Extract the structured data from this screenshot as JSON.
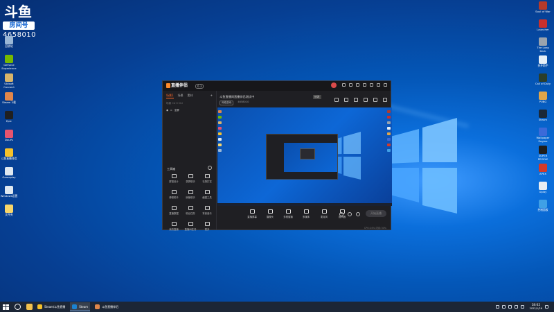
{
  "watermark": {
    "brand_glyph": "斗鱼",
    "tag": "房间号",
    "number": "4658010"
  },
  "desktop": {
    "left_icons": [
      {
        "label": "回收站",
        "color": "#9ab7d6"
      },
      {
        "label": "GeForce Experience",
        "color": "#76b900"
      },
      {
        "label": "Ubisoft Connect",
        "color": "#d7b46a"
      },
      {
        "label": "Steam下载",
        "color": "#e0864b"
      },
      {
        "label": "Epic",
        "color": "#202020"
      },
      {
        "label": "DouYu",
        "color": "#e7546f"
      },
      {
        "label": "斗鱼直播伴侣",
        "color": "#f6c12a"
      },
      {
        "label": "Gameplay",
        "color": "#dfe8f0"
      },
      {
        "label": "Windows设置",
        "color": "#dfe8f0"
      },
      {
        "label": "文件夹",
        "color": "#f7d56a"
      }
    ],
    "right_icons": [
      {
        "label": "Soul of War",
        "color": "#b53a2a"
      },
      {
        "label": "Launcher",
        "color": "#c9302c"
      },
      {
        "label": "The Long Dark",
        "color": "#9aa3ad"
      },
      {
        "label": "多开助手",
        "color": "#e7f0f7"
      },
      {
        "label": "Call of Duty",
        "color": "#2b3e2b"
      },
      {
        "label": "PUBG",
        "color": "#e0a64a"
      },
      {
        "label": "Steam",
        "color": "#1b2838"
      },
      {
        "label": "Wallpaper Engine",
        "color": "#3b6ad9"
      },
      {
        "label": "SUPER PEOPLE",
        "color": "#1d1d1d"
      },
      {
        "label": "APEX",
        "color": "#d33a2a"
      },
      {
        "label": "Uplay",
        "color": "#e9edf2"
      },
      {
        "label": "控制面板",
        "color": "#3fa0e6"
      }
    ]
  },
  "app": {
    "logo_text": "直播伴侣",
    "version_badge": "6.3",
    "tabs": [
      {
        "label": "场景1",
        "active": true
      },
      {
        "label": "场景",
        "active": false
      },
      {
        "label": "素材",
        "active": false
      }
    ],
    "scene_label": "场景 Ctrl+Ctrl",
    "layer_label": "全屏",
    "tools_title": "工具箱",
    "tools": [
      {
        "label": "屏幕设计"
      },
      {
        "label": "录屏助手"
      },
      {
        "label": "礼物打赏"
      },
      {
        "label": "弹幕助手"
      },
      {
        "label": "房管助手"
      },
      {
        "label": "截图工具"
      },
      {
        "label": "直播数据"
      },
      {
        "label": "粉丝任务"
      },
      {
        "label": "背景音乐"
      },
      {
        "label": "我的直播"
      },
      {
        "label": "直播间任务"
      },
      {
        "label": "更多"
      }
    ],
    "room_title": "斗鱼直播间直播伴侣测试中",
    "room_badge": "修改",
    "room_category": "网络游戏",
    "room_meta": "4658010",
    "bottom_actions": [
      {
        "label": "直播屏幕"
      },
      {
        "label": "摄像头"
      },
      {
        "label": "多视窗播"
      },
      {
        "label": "多媒体"
      },
      {
        "label": "麦克风"
      },
      {
        "label": "扬声器"
      }
    ],
    "go_live_label": "开始直播",
    "status_text": "CPU:24% 内存:30%"
  },
  "taskbar": {
    "apps": [
      {
        "label": "Steam/斗鱼直播",
        "color": "#f6c12a",
        "active": false
      },
      {
        "label": "Steam",
        "color": "#1b82d1",
        "active": true
      },
      {
        "label": "斗鱼直播伴侣",
        "color": "#e0864b",
        "active": false
      }
    ],
    "time": "18:02",
    "date": "2022/1/26"
  }
}
